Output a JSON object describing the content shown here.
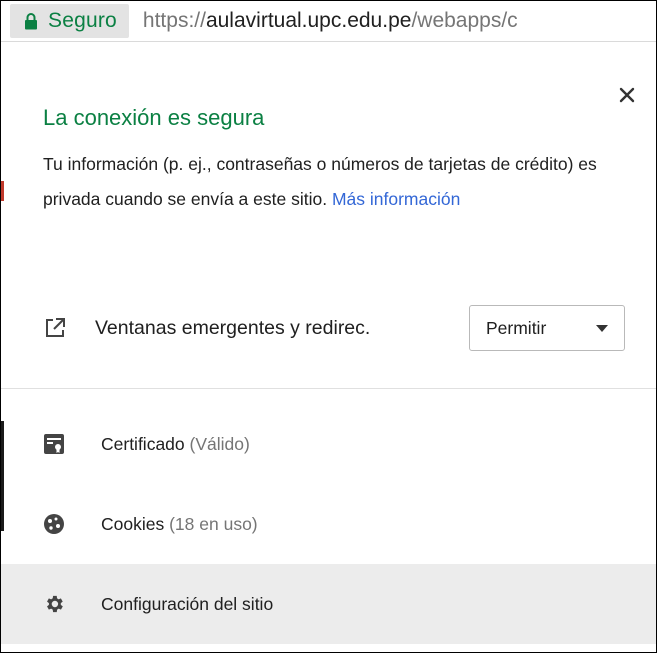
{
  "address_bar": {
    "secure_label": "Seguro",
    "url_scheme": "https://",
    "url_host": "aulavirtual.upc.edu.pe",
    "url_path": "/webapps/c"
  },
  "popup": {
    "title": "La conexión es segura",
    "description": "Tu información (p. ej., contraseñas o números de tarjetas de crédito) es privada cuando se envía a este sitio.",
    "more_info_link": "Más información",
    "permission": {
      "label": "Ventanas emergentes y redirec.",
      "selected": "Permitir"
    },
    "items": [
      {
        "label": "Certificado",
        "detail": "(Válido)",
        "icon": "certificate-icon"
      },
      {
        "label": "Cookies",
        "detail": "(18 en uso)",
        "icon": "cookie-icon"
      },
      {
        "label": "Configuración del sitio",
        "detail": "",
        "icon": "gear-icon"
      }
    ]
  },
  "colors": {
    "secure_green": "#0b8043",
    "link_blue": "#3367d6",
    "hover_bg": "#ececec"
  }
}
